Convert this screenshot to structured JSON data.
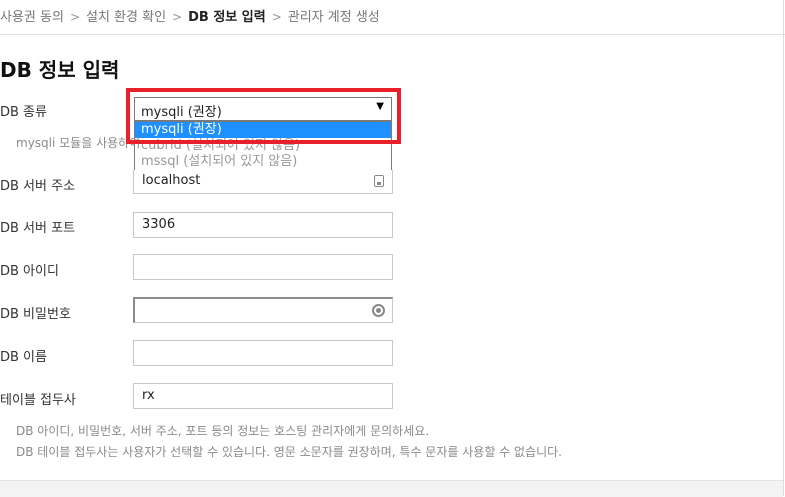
{
  "breadcrumb": {
    "steps": [
      "사용권 동의",
      "설치 환경 확인",
      "DB 정보 입력",
      "관리자 계정 생성"
    ],
    "separator": ">"
  },
  "page_title": "DB 정보 입력",
  "fields": {
    "db_type": {
      "label": "DB 종류",
      "value": "mysqli (권장)",
      "options": [
        "mysqli (권장)",
        "cubrid (설치되어 있지 않음)",
        "mssql (설치되어 있지 않음)"
      ],
      "help": "mysqli 모듈을 사용하여"
    },
    "db_host": {
      "label": "DB 서버 주소",
      "value": "localhost"
    },
    "db_port": {
      "label": "DB 서버 포트",
      "value": "3306"
    },
    "db_user": {
      "label": "DB 아이디",
      "value": ""
    },
    "db_password": {
      "label": "DB 비밀번호",
      "value": ""
    },
    "db_name": {
      "label": "DB 이름",
      "value": ""
    },
    "db_prefix": {
      "label": "테이블 접두사",
      "value": "rx"
    }
  },
  "help_texts": [
    "DB 아이디, 비밀번호, 서버 주소, 포트 등의 정보는 호스팅 관리자에게 문의하세요.",
    "DB 테이블 접두사는 사용자가 선택할 수 있습니다. 영문 소문자를 권장하며, 특수 문자를 사용할 수 없습니다."
  ],
  "colors": {
    "highlight_box": "#e8202a",
    "selected_option": "#1e90ff"
  },
  "icons": {
    "host_field": "contact-card-icon",
    "password_field": "password-reveal-icon",
    "select": "dropdown-arrow-icon"
  }
}
